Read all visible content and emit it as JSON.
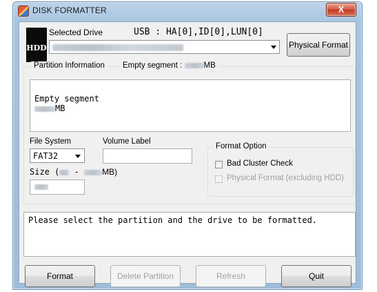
{
  "window": {
    "title": "DISK FORMATTER",
    "close_label": "X"
  },
  "drive": {
    "badge": "HDD",
    "selected_drive_label": "Selected Drive",
    "usb_info": "USB : HA[0],ID[0],LUN[0]",
    "physical_format_button": "Physical Format"
  },
  "partition": {
    "legend": "Partition Information",
    "empty_segment_label": "Empty segment :",
    "empty_segment_unit": "MB",
    "list_line1": "Empty segment",
    "list_line2_unit": "MB"
  },
  "format": {
    "file_system_label": "File System",
    "file_system_value": "FAT32",
    "volume_label_label": "Volume Label",
    "volume_label_value": "",
    "size_prefix": "Size (",
    "size_separator": "-",
    "size_suffix": "MB)"
  },
  "format_option": {
    "legend": "Format Option",
    "bad_cluster_label": "Bad Cluster Check",
    "bad_cluster_checked": false,
    "physical_format_excl_label": "Physical Format (excluding HDD)",
    "physical_format_excl_checked": false
  },
  "status": {
    "message": "Please select the partition and the drive to be formatted."
  },
  "buttons": {
    "format": "Format",
    "delete_partition": "Delete Partition",
    "refresh": "Refresh",
    "quit": "Quit"
  },
  "colors": {
    "window_frame": "#a8c4df",
    "client_bg": "#f0f0f0",
    "close_button": "#c23a22",
    "disabled_text": "#a0a0a0"
  }
}
